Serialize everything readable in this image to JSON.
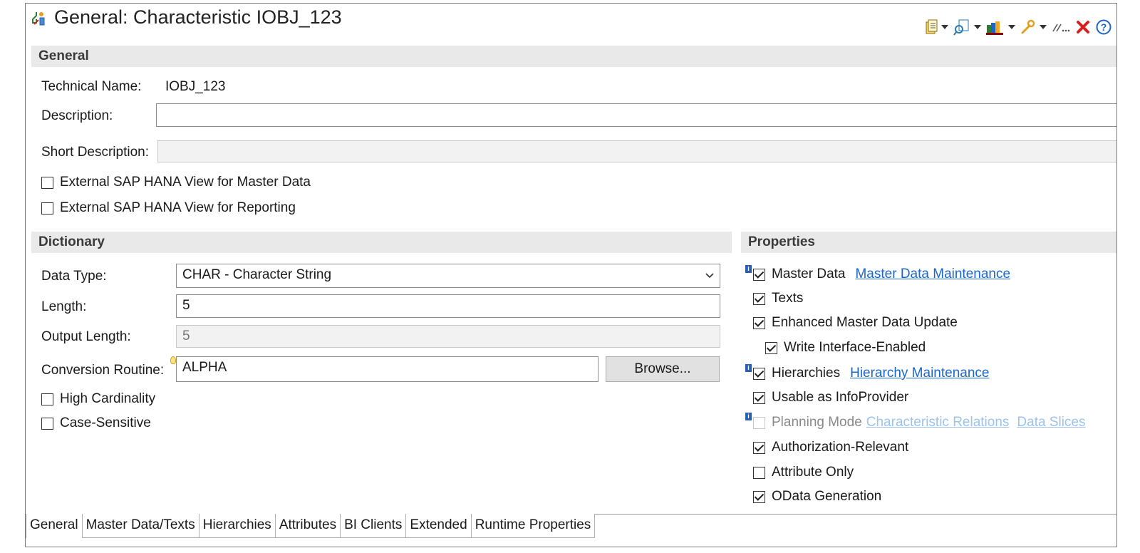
{
  "window": {
    "title": "General: Characteristic IOBJ_123"
  },
  "toolbar": {
    "icons": [
      "document-icon",
      "find-icon",
      "books-icon",
      "wrench-icon",
      "link-icon",
      "close-icon",
      "help-icon"
    ]
  },
  "general": {
    "section_title": "General",
    "technical_name_label": "Technical Name:",
    "technical_name_value": "IOBJ_123",
    "description_label": "Description:",
    "description_value": "",
    "short_description_label": "Short Description:",
    "short_description_value": "",
    "hana_master_data_label": "External SAP HANA View for Master Data",
    "hana_master_data_checked": false,
    "hana_reporting_label": "External SAP HANA View for Reporting",
    "hana_reporting_checked": false
  },
  "dictionary": {
    "section_title": "Dictionary",
    "data_type_label": "Data Type:",
    "data_type_value": "CHAR - Character String",
    "length_label": "Length:",
    "length_value": "5",
    "output_length_label": "Output Length:",
    "output_length_value": "5",
    "conversion_routine_label": "Conversion Routine:",
    "conversion_routine_value": "ALPHA",
    "browse_label": "Browse...",
    "high_cardinality_label": "High Cardinality",
    "case_sensitive_label": "Case-Sensitive"
  },
  "properties": {
    "section_title": "Properties",
    "master_data_label": "Master Data",
    "master_data_link": "Master Data Maintenance",
    "texts_label": "Texts",
    "enhanced_update_label": "Enhanced Master Data Update",
    "write_interface_label": "Write Interface-Enabled",
    "hierarchies_label": "Hierarchies",
    "hierarchies_link": "Hierarchy Maintenance",
    "infoprovider_label": "Usable as InfoProvider",
    "planning_mode_label": "Planning Mode",
    "char_relations_link": "Characteristic Relations",
    "data_slices_link": "Data Slices",
    "authorization_label": "Authorization-Relevant",
    "attribute_only_label": "Attribute Only",
    "odata_label": "OData Generation"
  },
  "tabs": [
    "General",
    "Master Data/Texts",
    "Hierarchies",
    "Attributes",
    "BI Clients",
    "Extended",
    "Runtime Properties"
  ],
  "colors": {
    "link": "#1a66cc",
    "section_bg": "#e9e9e9",
    "close_red": "#d9201f",
    "help_blue": "#1f63c5"
  }
}
